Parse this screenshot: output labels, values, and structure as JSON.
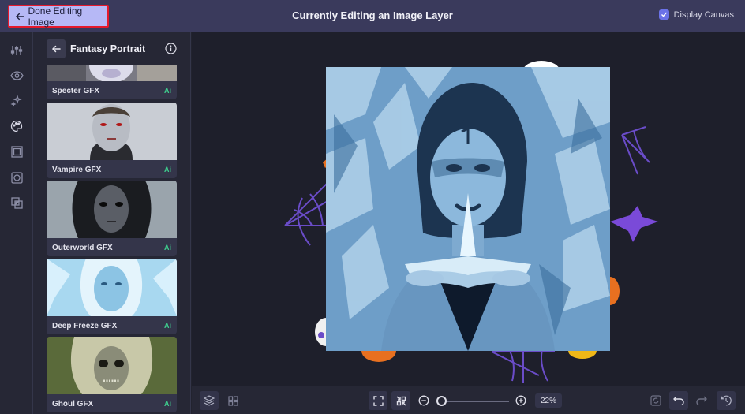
{
  "topbar": {
    "done_label": "Done Editing Image",
    "title": "Currently Editing an Image Layer",
    "display_canvas_label": "Display Canvas",
    "display_canvas_checked": true
  },
  "rail": {
    "icons": [
      "adjust-sliders-icon",
      "eye-icon",
      "magic-sparkle-icon",
      "palette-icon",
      "frame-icon",
      "mask-icon",
      "overlay-icon"
    ]
  },
  "panel": {
    "title": "Fantasy Portrait",
    "cards": [
      {
        "label": "Specter GFX",
        "badge": "Ai"
      },
      {
        "label": "Vampire GFX",
        "badge": "Ai"
      },
      {
        "label": "Outerworld GFX",
        "badge": "Ai"
      },
      {
        "label": "Deep Freeze GFX",
        "badge": "Ai"
      },
      {
        "label": "Ghoul GFX",
        "badge": "Ai"
      }
    ]
  },
  "bottombar": {
    "zoom": "22%"
  },
  "colors": {
    "accent": "#6b72e8",
    "ai_badge": "#3ecf8e",
    "highlight_border": "#e5192c"
  }
}
